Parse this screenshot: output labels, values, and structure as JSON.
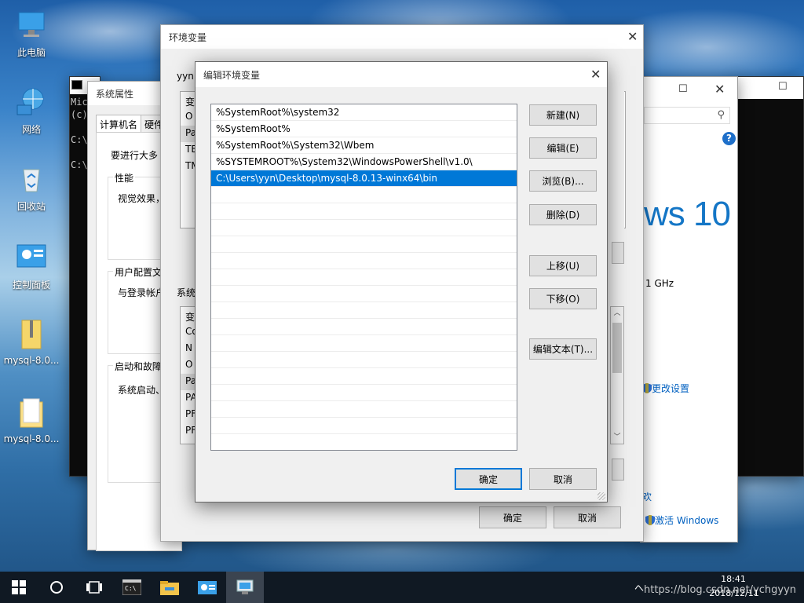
{
  "desktop": {
    "icons": [
      {
        "label": "此电脑",
        "icon": "computer-icon"
      },
      {
        "label": "网络",
        "icon": "network-icon"
      },
      {
        "label": "回收站",
        "icon": "recycle-bin-icon"
      },
      {
        "label": "控制面板",
        "icon": "control-panel-icon"
      },
      {
        "label": "mysql-8.0...",
        "icon": "zip-folder-icon"
      },
      {
        "label": "mysql-8.0...",
        "icon": "folder-icon"
      }
    ]
  },
  "cmd": {
    "lines": [
      "Mic",
      "(c)",
      "C:\\",
      "C:\\"
    ]
  },
  "system_props": {
    "title": "系统属性",
    "tabs": [
      "计算机名",
      "硬件"
    ],
    "intro": "要进行大多",
    "groups": [
      {
        "title": "性能",
        "text": "视觉效果，"
      },
      {
        "title": "用户配置文",
        "text": "与登录帐户"
      },
      {
        "title": "启动和故障",
        "text": "系统启动、"
      }
    ]
  },
  "env_vars": {
    "title": "环境变量",
    "user_section_label": "yyn",
    "user_header": "变",
    "user_rows": [
      "O",
      "Pa",
      "TE",
      "TM"
    ],
    "system_section_label": "系统",
    "system_header": "变",
    "system_rows": [
      "Co",
      "N",
      "O",
      "Pa",
      "PA",
      "PF",
      "PF"
    ],
    "ok_label": "确定",
    "cancel_label": "取消"
  },
  "system_info": {
    "brand_text": "ws 10",
    "cpu_text": "1 GHz",
    "change_settings": "更改设置",
    "activate_link_fragment": "欢",
    "activate_windows": "激活 Windows"
  },
  "edit_env": {
    "title": "编辑环境变量",
    "entries": [
      "%SystemRoot%\\system32",
      "%SystemRoot%",
      "%SystemRoot%\\System32\\Wbem",
      "%SYSTEMROOT%\\System32\\WindowsPowerShell\\v1.0\\",
      "C:\\Users\\yyn\\Desktop\\mysql-8.0.13-winx64\\bin"
    ],
    "selected_index": 4,
    "empty_rows": 15,
    "buttons": {
      "new": "新建(N)",
      "edit": "编辑(E)",
      "browse": "浏览(B)...",
      "delete": "删除(D)",
      "move_up": "上移(U)",
      "move_down": "下移(O)",
      "edit_text": "编辑文本(T)..."
    },
    "ok_label": "确定",
    "cancel_label": "取消"
  },
  "taskbar": {
    "time": "18:41",
    "date": "2018/12/11",
    "watermark": "https://blog.csdn.net/ychgyyn",
    "tray_text": "へ"
  },
  "colors": {
    "selection": "#0078d7",
    "taskbar": "#101923",
    "accent": "#0078d7"
  }
}
